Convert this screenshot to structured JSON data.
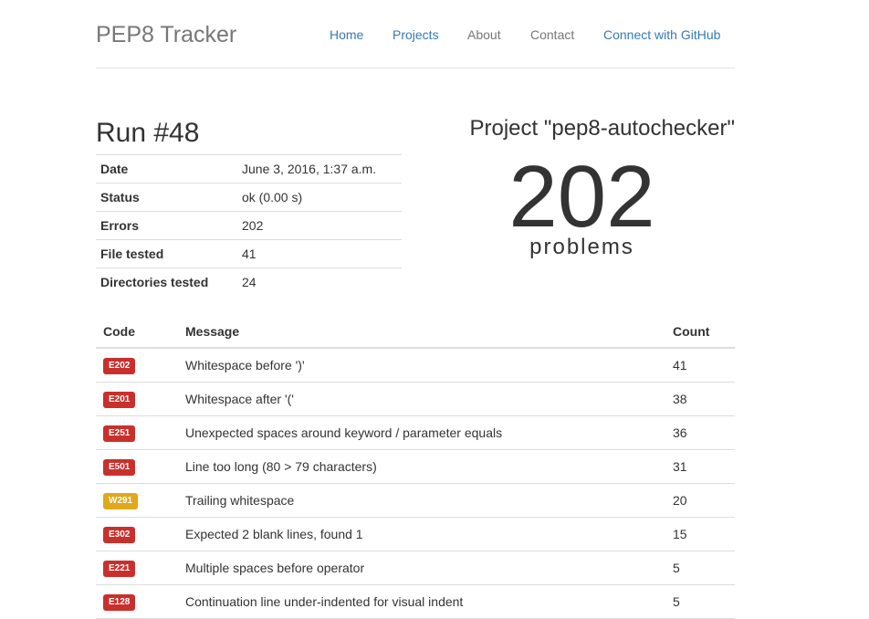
{
  "header": {
    "brand": "PEP8 Tracker",
    "nav": [
      {
        "label": "Home",
        "name": "nav-home",
        "style": "link"
      },
      {
        "label": "Projects",
        "name": "nav-projects",
        "style": "link"
      },
      {
        "label": "About",
        "name": "nav-about",
        "style": "muted"
      },
      {
        "label": "Contact",
        "name": "nav-contact",
        "style": "muted"
      },
      {
        "label": "Connect with GitHub",
        "name": "nav-connect-github",
        "style": "link"
      }
    ]
  },
  "run": {
    "title": "Run #48",
    "info": [
      {
        "key": "Date",
        "value": "June 3, 2016, 1:37 a.m."
      },
      {
        "key": "Status",
        "value": "ok (0.00 s)"
      },
      {
        "key": "Errors",
        "value": "202"
      },
      {
        "key": "File tested",
        "value": "41"
      },
      {
        "key": "Directories tested",
        "value": "24"
      }
    ]
  },
  "project": {
    "title": "Project \"pep8-autochecker\"",
    "problem_count": "202",
    "problem_label": "problems"
  },
  "errors": {
    "headers": {
      "code": "Code",
      "message": "Message",
      "count": "Count"
    },
    "colors": {
      "error": "#c9302c",
      "warning": "#e0a81c"
    },
    "rows": [
      {
        "code": "E202",
        "type": "error",
        "message": "Whitespace before ')'",
        "count": "41"
      },
      {
        "code": "E201",
        "type": "error",
        "message": "Whitespace after '('",
        "count": "38"
      },
      {
        "code": "E251",
        "type": "error",
        "message": "Unexpected spaces around keyword / parameter equals",
        "count": "36"
      },
      {
        "code": "E501",
        "type": "error",
        "message": "Line too long (80 > 79 characters)",
        "count": "31"
      },
      {
        "code": "W291",
        "type": "warning",
        "message": "Trailing whitespace",
        "count": "20"
      },
      {
        "code": "E302",
        "type": "error",
        "message": "Expected 2 blank lines, found 1",
        "count": "15"
      },
      {
        "code": "E221",
        "type": "error",
        "message": "Multiple spaces before operator",
        "count": "5"
      },
      {
        "code": "E128",
        "type": "error",
        "message": "Continuation line under-indented for visual indent",
        "count": "5"
      }
    ]
  }
}
